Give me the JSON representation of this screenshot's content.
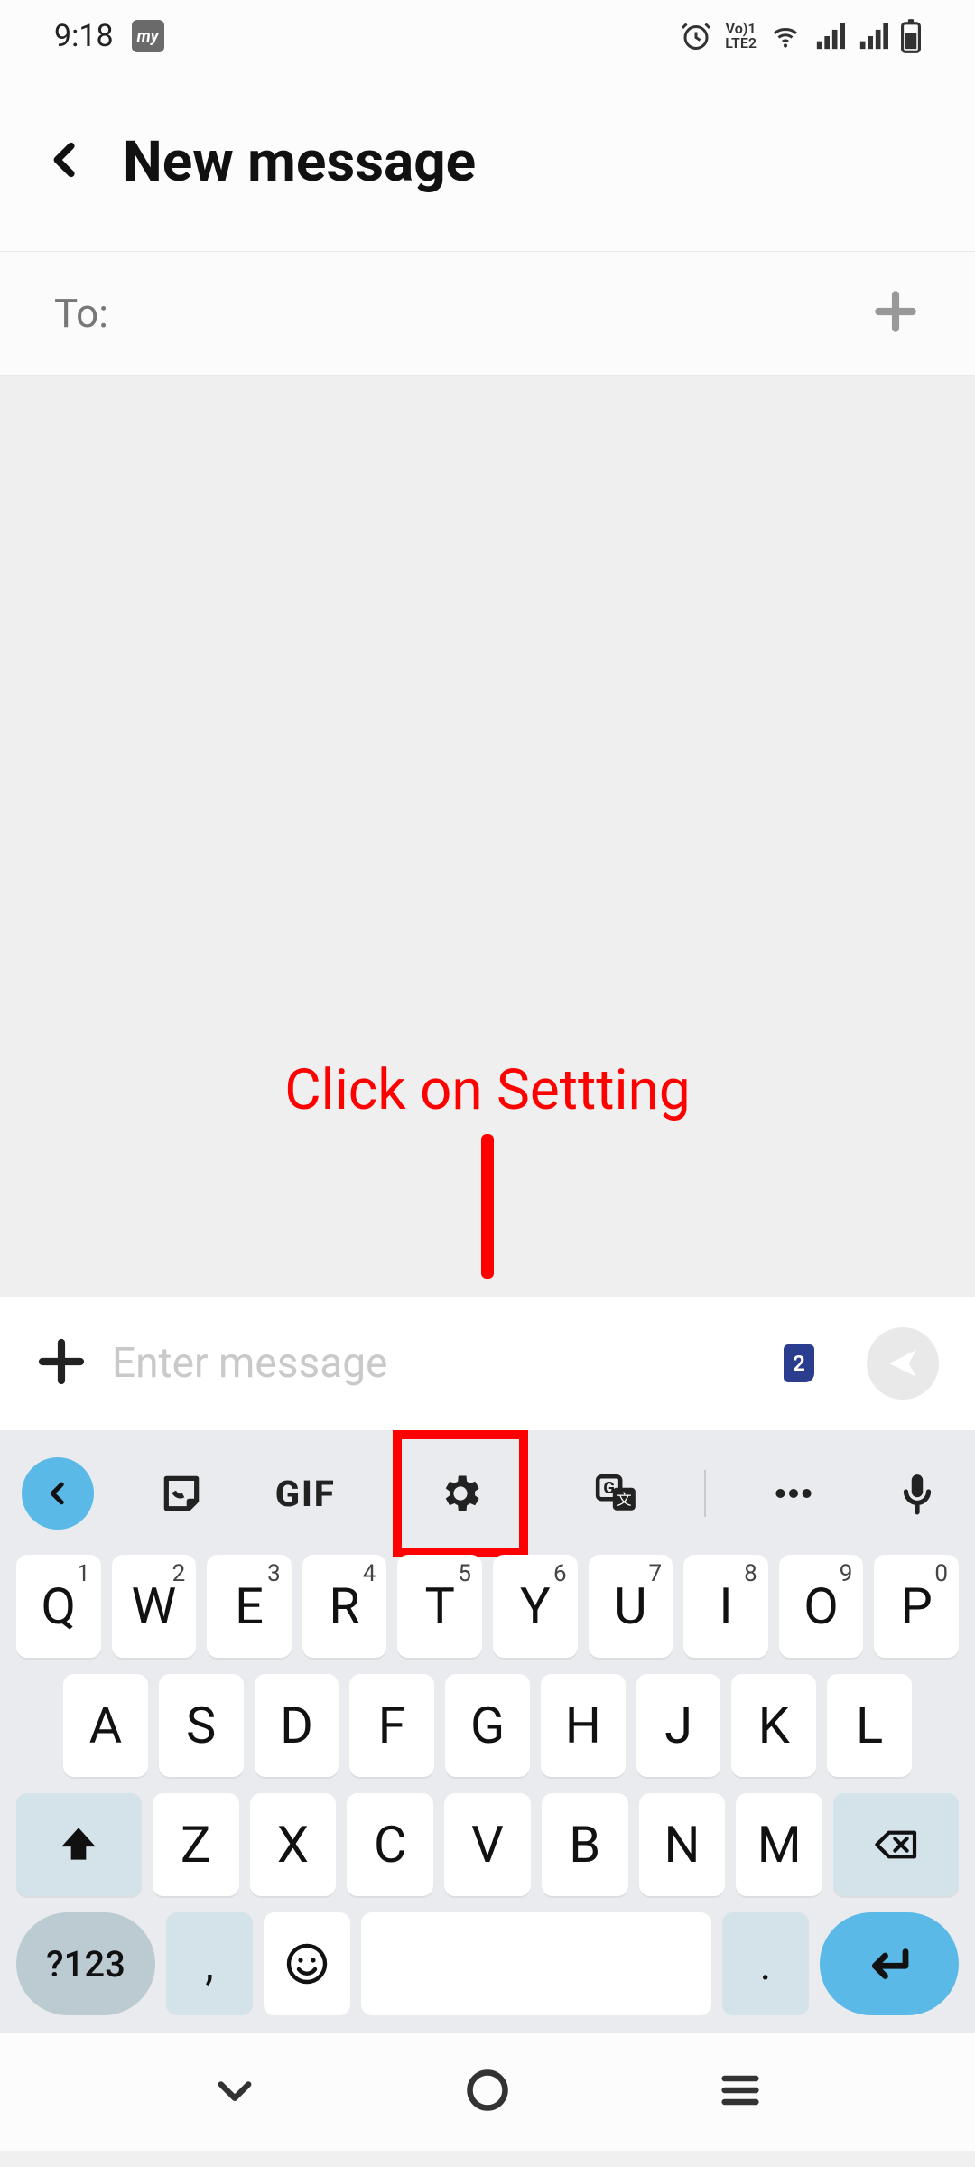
{
  "status": {
    "time": "9:18",
    "lte_label": "Vo)1\nLTE2"
  },
  "header": {
    "title": "New message"
  },
  "to_field": {
    "label": "To:",
    "value": ""
  },
  "annotation": {
    "text": "Click on Settting"
  },
  "compose": {
    "placeholder": "Enter message",
    "value": "",
    "sim": "2"
  },
  "keyboard": {
    "gif_label": "GIF",
    "row1": [
      {
        "k": "Q",
        "d": "1"
      },
      {
        "k": "W",
        "d": "2"
      },
      {
        "k": "E",
        "d": "3"
      },
      {
        "k": "R",
        "d": "4"
      },
      {
        "k": "T",
        "d": "5"
      },
      {
        "k": "Y",
        "d": "6"
      },
      {
        "k": "U",
        "d": "7"
      },
      {
        "k": "I",
        "d": "8"
      },
      {
        "k": "O",
        "d": "9"
      },
      {
        "k": "P",
        "d": "0"
      }
    ],
    "row2": [
      "A",
      "S",
      "D",
      "F",
      "G",
      "H",
      "J",
      "K",
      "L"
    ],
    "row3": [
      "Z",
      "X",
      "C",
      "V",
      "B",
      "N",
      "M"
    ],
    "sym": "?123",
    "comma": ",",
    "period": "."
  }
}
